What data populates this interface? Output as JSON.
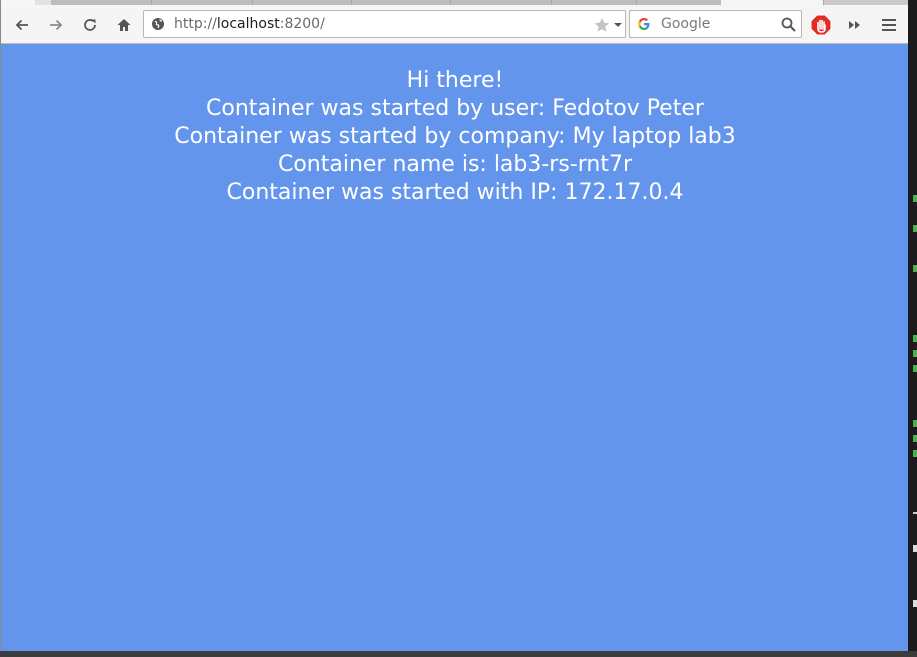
{
  "browser": {
    "url_scheme": "http://",
    "url_host": "localhost",
    "url_rest": ":8200/",
    "search_placeholder": "Google",
    "icons": {
      "back": "back-arrow-icon",
      "forward": "forward-arrow-icon",
      "reload": "reload-icon",
      "home": "home-icon",
      "site_info": "globe-icon",
      "bookmark": "star-icon",
      "dropdown": "chevron-down-icon",
      "search_engine": "google-icon",
      "search": "magnifier-icon",
      "adblock": "stop-hand-icon",
      "overflow": "double-chevron-icon",
      "menu": "hamburger-menu-icon"
    }
  },
  "page": {
    "background_color": "#6495ED",
    "lines": [
      "Hi there!",
      "Container was started by user: Fedotov Peter",
      "Container was started by company: My laptop lab3",
      "Container name is: lab3-rs-rnt7r",
      "Container was started with IP: 172.17.0.4"
    ]
  }
}
